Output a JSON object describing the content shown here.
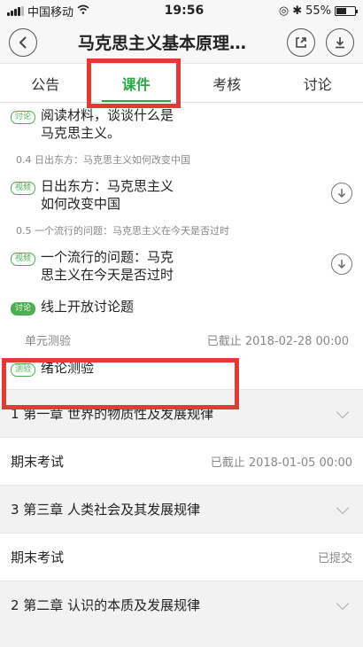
{
  "status_bar": {
    "carrier": "中国移动",
    "time": "19:56",
    "battery": "55%",
    "battery_level": 0.55
  },
  "nav": {
    "title": "马克思主义基本原理…",
    "back_icon": "back-chevron-icon",
    "share_icon": "share-icon",
    "download_icon": "download-icon"
  },
  "tabs": [
    {
      "label": "公告"
    },
    {
      "label": "课件"
    },
    {
      "label": "考核"
    },
    {
      "label": "讨论"
    }
  ],
  "items": [
    {
      "badge": "讨论",
      "text": "阅读材料，谈谈什么是马克思主义。"
    },
    {
      "section": "0.4 日出东方：马克思主义如何改变中国"
    },
    {
      "badge": "视频",
      "text": "日出东方：马克思主义如何改变中国"
    },
    {
      "section": "0.5 一个流行的问题：马克思主义在今天是否过时"
    },
    {
      "badge": "视频",
      "text": "一个流行的问题：马克思主义在今天是否过时"
    },
    {
      "badge": "讨论",
      "text": "线上开放讨论题"
    }
  ],
  "unit_test": {
    "label": "单元测验",
    "status": "已截止 2018-02-28 00:00",
    "badge": "测验",
    "text": "绪论测验"
  },
  "chapters": [
    {
      "label": "1  第一章  世界的物质性及发展规律"
    },
    {
      "label": "期末考试",
      "status": "已截止  2018-01-05 00:00"
    },
    {
      "label": "3 第三章  人类社会及其发展规律"
    },
    {
      "label": "期末考试",
      "status": "已提交"
    },
    {
      "label": "2 第二章  认识的本质及发展规律"
    }
  ]
}
